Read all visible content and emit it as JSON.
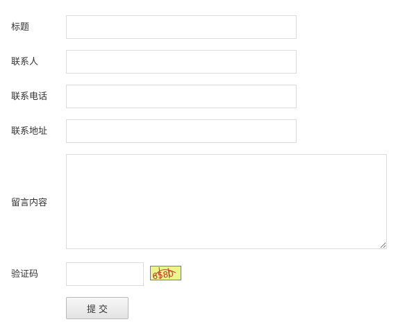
{
  "form": {
    "title_label": "标题",
    "contact_label": "联系人",
    "phone_label": "联系电话",
    "address_label": "联系地址",
    "message_label": "留言内容",
    "captcha_label": "验证码",
    "captcha_text": "6580",
    "submit_label": "提交",
    "title_value": "",
    "contact_value": "",
    "phone_value": "",
    "address_value": "",
    "message_value": "",
    "captcha_value": ""
  },
  "colors": {
    "label_text": "#333333",
    "input_border": "#dcdcdc",
    "captcha_background": "#eaf58a",
    "captcha_text": "#c0392b"
  }
}
